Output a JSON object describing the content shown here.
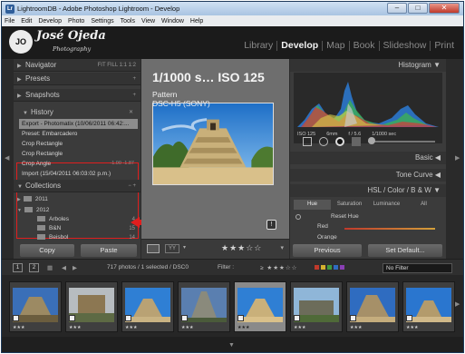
{
  "window": {
    "title": "LightroomDB - Adobe Photoshop Lightroom - Develop",
    "app_icon": "Lr"
  },
  "menu": [
    "File",
    "Edit",
    "Develop",
    "Photo",
    "Settings",
    "Tools",
    "View",
    "Window",
    "Help"
  ],
  "identity": {
    "mark": "JO",
    "name": "José Ojeda",
    "sub": "Photography"
  },
  "modules": [
    {
      "label": "Library",
      "active": false
    },
    {
      "label": "Develop",
      "active": true
    },
    {
      "label": "Map",
      "active": false
    },
    {
      "label": "Book",
      "active": false
    },
    {
      "label": "Slideshow",
      "active": false
    },
    {
      "label": "Print",
      "active": false
    }
  ],
  "left": {
    "navigator": "Navigator",
    "navigator_zoom": "FIT  FILL  1:1  1:2",
    "presets": "Presets",
    "snapshots": "Snapshots",
    "history": "History",
    "history_items": [
      {
        "label": "Export - Photomatix (10/06/2011 06:42:...",
        "vals": ""
      },
      {
        "label": "Preset: Embarcadero",
        "vals": ""
      },
      {
        "label": "Crop Rectangle",
        "vals": ""
      },
      {
        "label": "Crop Rectangle",
        "vals": ""
      },
      {
        "label": "Crop Angle",
        "vals": "-1.00    -1.87"
      },
      {
        "label": "Import (15/04/2011 06:03:02 p.m.)",
        "vals": ""
      }
    ],
    "collections": "Collections",
    "collections_actions": "−  +",
    "folders": [
      {
        "label": "2011",
        "count": ""
      },
      {
        "label": "2012",
        "count": ""
      },
      {
        "label": "Arboles",
        "count": "4"
      },
      {
        "label": "B&N",
        "count": "15"
      },
      {
        "label": "Beisbol",
        "count": "14"
      }
    ],
    "copy": "Copy",
    "paste": "Paste"
  },
  "center": {
    "line1": "1/1000 s… ISO 125",
    "line2": "Pattern",
    "line3": "DSC-H5 (SONY)",
    "info_icon": "!"
  },
  "right": {
    "histogram": "Histogram",
    "iso": "ISO 125",
    "focal": "6mm",
    "aperture": "f / 5.6",
    "shutter": "1/1000 sec",
    "basic": "Basic",
    "tone_curve": "Tone Curve",
    "hsl_header": "HSL  /  Color  /  B & W",
    "hsl_tabs": [
      "Hue",
      "Saturation",
      "Luminance",
      "All"
    ],
    "reset_hue": "Reset Hue",
    "red": "Red",
    "orange": "Orange",
    "previous": "Previous",
    "set_default": "Set Default..."
  },
  "filmbar": {
    "page1": "1",
    "page2": "2",
    "count": "717 photos / 1 selected / DSC0",
    "filter": "Filter :",
    "no_filter": "No Filter"
  },
  "toolbar": {
    "stars": "★★★☆☆"
  },
  "colors": {
    "highlight": "#e01e1e",
    "panel": "#3b3b3b",
    "accent_sky": "#2f7fd4"
  }
}
